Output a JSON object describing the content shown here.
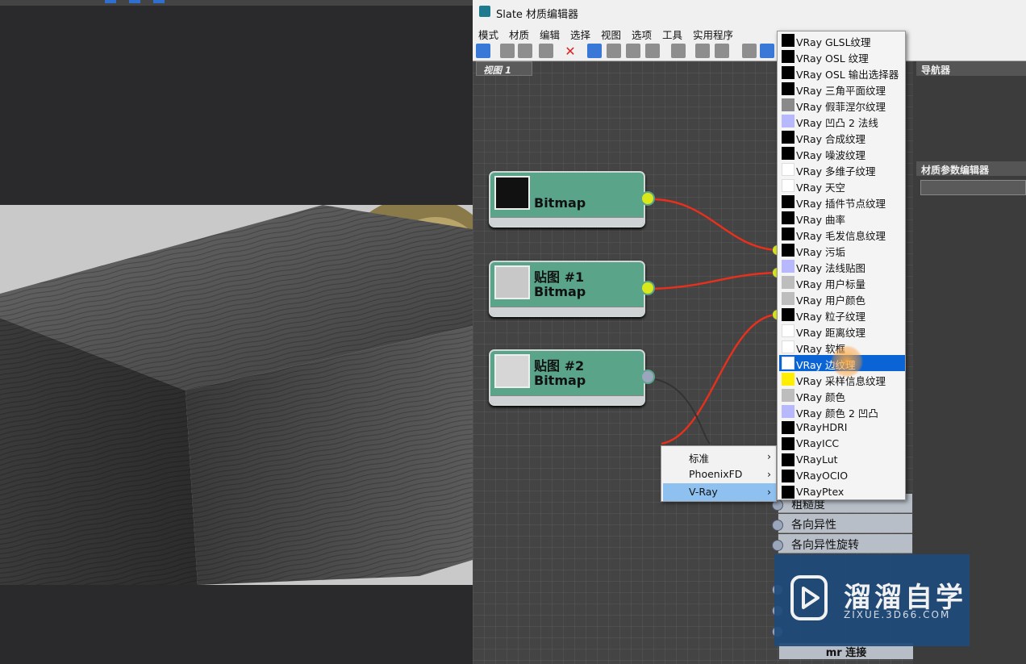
{
  "window": {
    "title": "Slate 材质编辑器"
  },
  "menu": [
    "模式",
    "材质",
    "编辑",
    "选择",
    "视图",
    "选项",
    "工具",
    "实用程序"
  ],
  "view_tab": "视图 1",
  "panels": {
    "navigator": "导航器",
    "param_editor": "材质参数编辑器"
  },
  "nodes": [
    {
      "title": "",
      "type": "Bitmap",
      "port": "connected",
      "thumb": "dark"
    },
    {
      "title": "贴图 #1",
      "type": "Bitmap",
      "port": "connected",
      "thumb": "light"
    },
    {
      "title": "贴图 #2",
      "type": "Bitmap",
      "port": "open",
      "thumb": "light"
    }
  ],
  "param_list": [
    "粗糙度",
    "各向异性",
    "各向异性旋转"
  ],
  "bottom_item": "mr 连接",
  "context_menu": [
    {
      "label": "标准",
      "arrow": "›"
    },
    {
      "label": "PhoenixFD",
      "arrow": "›"
    },
    {
      "label": "V-Ray",
      "arrow": "›",
      "selected": true
    }
  ],
  "vray_submenu": [
    {
      "label": "VRay GLSL纹理",
      "swatch": "#000000"
    },
    {
      "label": "VRay OSL 纹理",
      "swatch": "#000000"
    },
    {
      "label": "VRay OSL 输出选择器",
      "swatch": "#000000"
    },
    {
      "label": "VRay 三角平面纹理",
      "swatch": "#000000"
    },
    {
      "label": "VRay 假菲涅尔纹理",
      "swatch": "#8a8a8a"
    },
    {
      "label": "VRay 凹凸 2 法线",
      "swatch": "#b8b8ff"
    },
    {
      "label": "VRay 合成纹理",
      "swatch": "#000000"
    },
    {
      "label": "VRay 噪波纹理",
      "swatch": "#000000"
    },
    {
      "label": "VRay 多维子纹理",
      "swatch": "#ffffff"
    },
    {
      "label": "VRay 天空",
      "swatch": "#ffffff"
    },
    {
      "label": "VRay 插件节点纹理",
      "swatch": "#000000"
    },
    {
      "label": "VRay 曲率",
      "swatch": "#000000"
    },
    {
      "label": "VRay 毛发信息纹理",
      "swatch": "#000000"
    },
    {
      "label": "VRay 污垢",
      "swatch": "#000000"
    },
    {
      "label": "VRay 法线贴图",
      "swatch": "#b8b8ff"
    },
    {
      "label": "VRay 用户标量",
      "swatch": "#bdbdbd"
    },
    {
      "label": "VRay 用户颜色",
      "swatch": "#bdbdbd"
    },
    {
      "label": "VRay 粒子纹理",
      "swatch": "#000000"
    },
    {
      "label": "VRay 距离纹理",
      "swatch": "#ffffff"
    },
    {
      "label": "VRay 软框",
      "swatch": "#ffffff"
    },
    {
      "label": "VRay 边纹理",
      "swatch": "#ffffff",
      "selected": true
    },
    {
      "label": "VRay 采样信息纹理",
      "swatch": "#ffee00"
    },
    {
      "label": "VRay 颜色",
      "swatch": "#bdbdbd"
    },
    {
      "label": "VRay 颜色 2 凹凸",
      "swatch": "#b8b8ff"
    },
    {
      "label": "VRayHDRI",
      "swatch": "#000000"
    },
    {
      "label": "VRayICC",
      "swatch": "#000000"
    },
    {
      "label": "VRayLut",
      "swatch": "#000000"
    },
    {
      "label": "VRayOCIO",
      "swatch": "#000000"
    },
    {
      "label": "VRayPtex",
      "swatch": "#000000"
    }
  ],
  "watermark": {
    "title": "溜溜自学",
    "subtitle": "ZIXUE.3D66.COM"
  },
  "colors": {
    "node": "#5aa58a",
    "port_connected": "#d8e81a",
    "port_open": "#9aa6bb",
    "wire": "#e8301c",
    "selection": "#0a64d6"
  }
}
